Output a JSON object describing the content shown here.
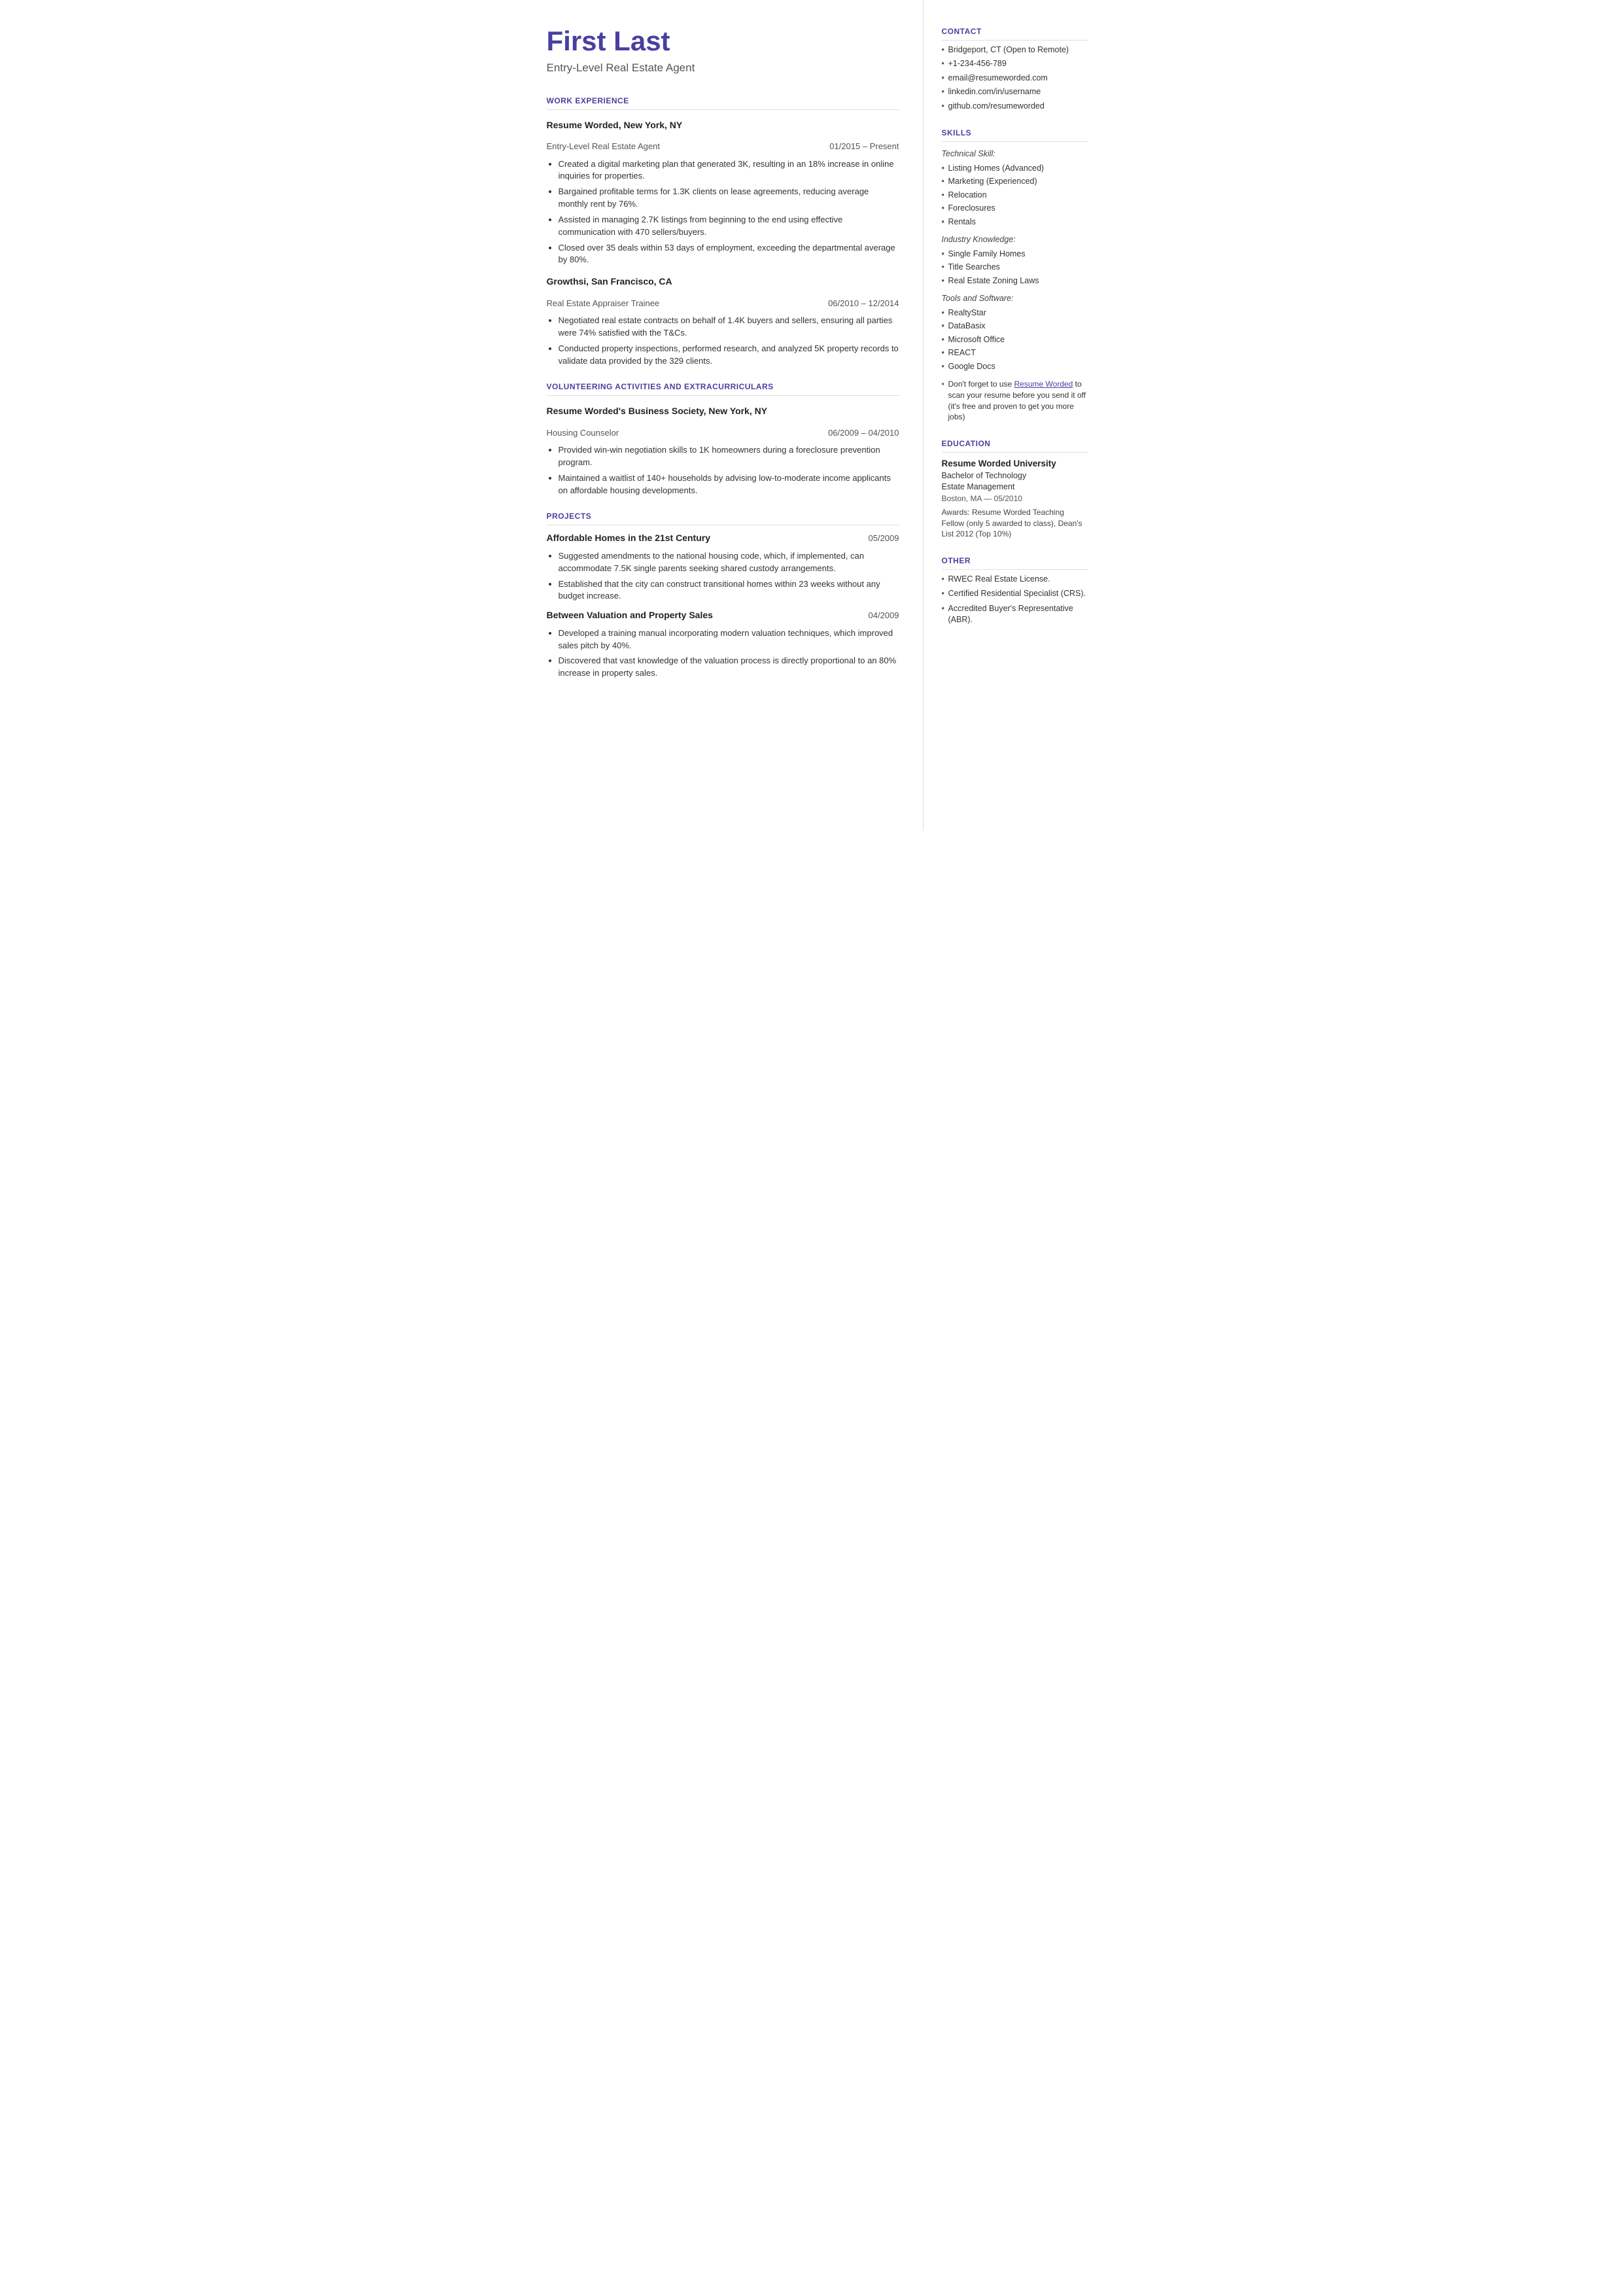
{
  "header": {
    "name": "First Last",
    "title": "Entry-Level Real Estate Agent"
  },
  "contact": {
    "section_label": "CONTACT",
    "items": [
      "Bridgeport, CT (Open to Remote)",
      "+1-234-456-789",
      "email@resumeworded.com",
      "linkedin.com/in/username",
      "github.com/resumeworded"
    ]
  },
  "skills": {
    "section_label": "SKILLS",
    "technical_label": "Technical Skill:",
    "technical_items": [
      "Listing Homes (Advanced)",
      "Marketing (Experienced)",
      "Relocation",
      "Foreclosures",
      "Rentals"
    ],
    "industry_label": "Industry Knowledge:",
    "industry_items": [
      "Single Family Homes",
      "Title Searches",
      "Real Estate Zoning Laws"
    ],
    "tools_label": "Tools and Software:",
    "tools_items": [
      "RealtyStar",
      "DataBasix",
      "Microsoft Office",
      "REACT",
      "Google Docs"
    ],
    "promo_text": "Don't forget to use Resume Worded to scan your resume before you send it off (it's free and proven to get you more jobs)",
    "promo_link": "Resume Worded"
  },
  "education": {
    "section_label": "EDUCATION",
    "school": "Resume Worded University",
    "degree": "Bachelor of Technology",
    "field": "Estate Management",
    "location": "Boston, MA — 05/2010",
    "awards": "Awards: Resume Worded Teaching Fellow (only 5 awarded to class), Dean's List 2012 (Top 10%)"
  },
  "other": {
    "section_label": "OTHER",
    "items": [
      "RWEC Real Estate License.",
      "Certified Residential Specialist (CRS).",
      "Accredited Buyer's Representative (ABR)."
    ]
  },
  "work_experience": {
    "section_label": "WORK EXPERIENCE",
    "jobs": [
      {
        "company": "Resume Worded, New York, NY",
        "role": "Entry-Level Real Estate Agent",
        "dates": "01/2015 – Present",
        "bullets": [
          "Created a digital marketing plan that generated 3K, resulting in an 18% increase in online inquiries for properties.",
          "Bargained profitable terms for 1.3K clients on lease agreements, reducing average monthly rent by 76%.",
          "Assisted in managing 2.7K listings from beginning to the end using effective communication with 470 sellers/buyers.",
          "Closed over 35 deals within 53 days of employment, exceeding the departmental average by 80%."
        ]
      },
      {
        "company": "Growthsi, San Francisco, CA",
        "role": "Real Estate Appraiser Trainee",
        "dates": "06/2010 – 12/2014",
        "bullets": [
          "Negotiated real estate contracts on behalf of 1.4K buyers and sellers, ensuring all parties were 74% satisfied with the T&Cs.",
          "Conducted property inspections, performed research, and analyzed 5K property records to validate data provided by the 329 clients."
        ]
      }
    ]
  },
  "volunteering": {
    "section_label": "VOLUNTEERING ACTIVITIES AND EXTRACURRICULARS",
    "items": [
      {
        "company": "Resume Worded's Business Society, New York, NY",
        "role": "Housing Counselor",
        "dates": "06/2009 – 04/2010",
        "bullets": [
          "Provided win-win negotiation skills to 1K homeowners during a foreclosure prevention program.",
          "Maintained a waitlist of 140+ households by advising low-to-moderate income applicants on affordable housing developments."
        ]
      }
    ]
  },
  "projects": {
    "section_label": "PROJECTS",
    "items": [
      {
        "title": "Affordable Homes in the 21st Century",
        "date": "05/2009",
        "bullets": [
          "Suggested amendments to the national housing code, which, if implemented, can accommodate 7.5K single parents seeking shared custody arrangements.",
          "Established that the city can construct transitional homes within 23 weeks without any budget increase."
        ]
      },
      {
        "title": "Between Valuation and Property Sales",
        "date": "04/2009",
        "bullets": [
          "Developed a training manual incorporating modern valuation techniques, which improved sales pitch by 40%.",
          "Discovered that vast knowledge of the valuation process is directly proportional to an 80% increase in property sales."
        ]
      }
    ]
  }
}
